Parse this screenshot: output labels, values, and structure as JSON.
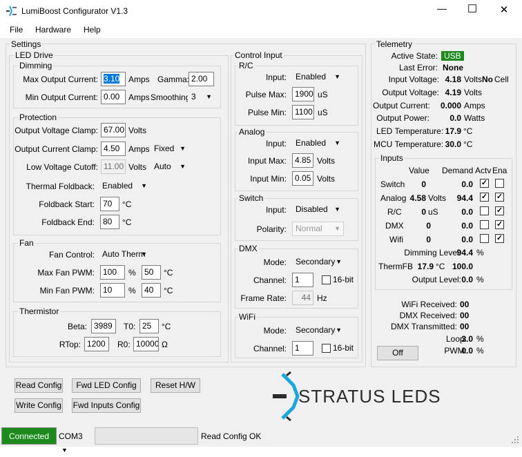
{
  "window": {
    "title": "LumiBoost Configurator  V1.3",
    "minimize_glyph": "—",
    "maximize_glyph": "☐",
    "close_glyph": "✕"
  },
  "menu": {
    "file": "File",
    "hardware": "Hardware",
    "help": "Help"
  },
  "settings": {
    "title": "Settings",
    "led_drive": {
      "title": "LED Drive",
      "dimming": {
        "title": "Dimming",
        "max_output_current_label": "Max Output Current:",
        "max_output_current": "3.10",
        "max_unit": "Amps",
        "gamma_label": "Gamma:",
        "gamma": "2.00",
        "min_output_current_label": "Min Output Current:",
        "min_output_current": "0.00",
        "min_unit": "Amps",
        "smoothing_label": "Smoothing:",
        "smoothing": "3"
      },
      "protection": {
        "title": "Protection",
        "ov_clamp_label": "Output Voltage Clamp:",
        "ov_clamp": "67.00",
        "ov_unit": "Volts",
        "oc_clamp_label": "Output Current Clamp:",
        "oc_clamp": "4.50",
        "oc_unit": "Amps",
        "oc_mode": "Fixed",
        "lv_cutoff_label": "Low Voltage Cutoff:",
        "lv_cutoff": "11.00",
        "lv_unit": "Volts",
        "lv_mode": "Auto",
        "thermal_foldback_label": "Thermal Foldback:",
        "thermal_foldback": "Enabled",
        "foldback_start_label": "Foldback Start:",
        "foldback_start": "70",
        "foldback_start_unit": "°C",
        "foldback_end_label": "Foldback End:",
        "foldback_end": "80",
        "foldback_end_unit": "°C"
      },
      "fan": {
        "title": "Fan",
        "control_label": "Fan Control:",
        "control": "Auto Therm",
        "max_pwm_label": "Max Fan PWM:",
        "max_pwm": "100",
        "max_pwm_unit": "%",
        "max_temp": "50",
        "max_temp_unit": "°C",
        "min_pwm_label": "Min Fan PWM:",
        "min_pwm": "10",
        "min_pwm_unit": "%",
        "min_temp": "40",
        "min_temp_unit": "°C"
      },
      "thermistor": {
        "title": "Thermistor",
        "beta_label": "Beta:",
        "beta": "3989",
        "t0_label": "T0:",
        "t0": "25",
        "t0_unit": "°C",
        "rtop_label": "RTop:",
        "rtop": "1200",
        "r0_label": "R0:",
        "r0": "10000",
        "r0_unit": "Ω"
      }
    },
    "control_input": {
      "title": "Control Input",
      "rc": {
        "title": "R/C",
        "input_label": "Input:",
        "input": "Enabled",
        "pulse_max_label": "Pulse Max:",
        "pulse_max": "1900",
        "pulse_max_unit": "uS",
        "pulse_min_label": "Pulse Min:",
        "pulse_min": "1100",
        "pulse_min_unit": "uS"
      },
      "analog": {
        "title": "Analog",
        "input_label": "Input:",
        "input": "Enabled",
        "input_max_label": "Input Max:",
        "input_max": "4.85",
        "input_max_unit": "Volts",
        "input_min_label": "Input Min:",
        "input_min": "0.05",
        "input_min_unit": "Volts"
      },
      "switch": {
        "title": "Switch",
        "input_label": "Input:",
        "input": "Disabled",
        "polarity_label": "Polarity:",
        "polarity": "Normal"
      },
      "dmx": {
        "title": "DMX",
        "mode_label": "Mode:",
        "mode": "Secondary",
        "channel_label": "Channel:",
        "channel": "1",
        "bit16_label": "16-bit",
        "frame_rate_label": "Frame Rate:",
        "frame_rate": "44",
        "frame_rate_unit": "Hz"
      },
      "wifi": {
        "title": "WiFi",
        "mode_label": "Mode:",
        "mode": "Secondary",
        "channel_label": "Channel:",
        "channel": "1",
        "bit16_label": "16-bit"
      }
    }
  },
  "telemetry": {
    "title": "Telemetry",
    "active_state_label": "Active State:",
    "active_state": "USB",
    "last_error_label": "Last Error:",
    "last_error": "None",
    "input_voltage_label": "Input Voltage:",
    "input_voltage": "4.18",
    "input_voltage_unit": "Volts",
    "no_cell": "No",
    "cell_label": "Cell",
    "output_voltage_label": "Output Voltage:",
    "output_voltage": "4.19",
    "output_voltage_unit": "Volts",
    "output_current_label": "Output Current:",
    "output_current": "0.000",
    "output_current_unit": "Amps",
    "output_power_label": "Output Power:",
    "output_power": "0.0",
    "output_power_unit": "Watts",
    "led_temp_label": "LED Temperature:",
    "led_temp": "17.9",
    "led_temp_unit": "°C",
    "mcu_temp_label": "MCU Temperature:",
    "mcu_temp": "30.0",
    "mcu_temp_unit": "°C",
    "inputs": {
      "title": "Inputs",
      "headers": {
        "value": "Value",
        "demand": "Demand",
        "actv": "Actv",
        "ena": "Ena"
      },
      "rows": [
        {
          "name": "Switch",
          "value": "0",
          "unit": "",
          "demand": "0.0",
          "actv": true,
          "ena": false
        },
        {
          "name": "Analog",
          "value": "4.58",
          "unit": "Volts",
          "demand": "94.4",
          "actv": true,
          "ena": true
        },
        {
          "name": "R/C",
          "value": "0",
          "unit": "uS",
          "demand": "0.0",
          "actv": false,
          "ena": true
        },
        {
          "name": "DMX",
          "value": "0",
          "unit": "",
          "demand": "0.0",
          "actv": false,
          "ena": true
        },
        {
          "name": "Wifi",
          "value": "0",
          "unit": "",
          "demand": "0.0",
          "actv": false,
          "ena": true
        }
      ],
      "dimming_level_label": "Dimming Level:",
      "dimming_level": "94.4",
      "dimming_level_unit": "%",
      "thermfb_label": "ThermFB",
      "thermfb_temp": "17.9",
      "thermfb_unit": "°C",
      "thermfb_value": "100.0",
      "output_level_label": "Output Level:",
      "output_level": "0.0",
      "output_level_unit": "%"
    },
    "wifi_received_label": "WiFi Received:",
    "wifi_received": "00",
    "dmx_received_label": "DMX Received:",
    "dmx_received": "00",
    "dmx_transmitted_label": "DMX Transmitted:",
    "dmx_transmitted": "00",
    "loop_label": "Loop:",
    "loop": "3.0",
    "loop_unit": "%",
    "pwm_label": "PWM:",
    "pwm": "0.0",
    "pwm_unit": "%",
    "off_button": "Off"
  },
  "buttons": {
    "read_config": "Read Config",
    "fwd_led_config": "Fwd LED Config",
    "reset_hw": "Reset H/W",
    "write_config": "Write Config",
    "fwd_inputs_config": "Fwd Inputs Config"
  },
  "logo": {
    "text": "STRATUS LEDS"
  },
  "status": {
    "connected": "Connected",
    "port": "COM3",
    "message": "Read Config OK"
  },
  "colors": {
    "connected_bg": "#1c8a1c",
    "usb_bg": "#1c8a1c",
    "logo_accent": "#1aa6e0",
    "logo_dark": "#2b2b2b"
  }
}
